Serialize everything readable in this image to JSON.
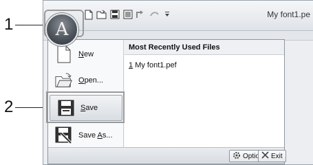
{
  "callouts": {
    "one": "1",
    "two": "2"
  },
  "window": {
    "title": "My font1.pe",
    "app_button_letter": "A"
  },
  "quick_access": [
    {
      "icon": "new-document-icon"
    },
    {
      "icon": "open-folder-icon"
    },
    {
      "icon": "save-disk-icon"
    },
    {
      "icon": "save-as-icon"
    },
    {
      "icon": "undo-icon"
    },
    {
      "icon": "redo-icon"
    },
    {
      "icon": "customize-qat-icon"
    }
  ],
  "menu": {
    "items": [
      {
        "label": "New",
        "accel": "N",
        "icon": "new-document-icon"
      },
      {
        "label": "Open...",
        "accel": "O",
        "icon": "open-folder-icon"
      },
      {
        "label": "Save",
        "accel": "S",
        "icon": "save-disk-icon"
      },
      {
        "label": "Save As...",
        "accel": "A",
        "icon": "save-as-icon"
      }
    ],
    "recent_title": "Most Recently Used Files",
    "recent_files": [
      {
        "index": "1",
        "name": "My font1.pef"
      }
    ],
    "options_label": "Options",
    "exit_label": "Exit"
  }
}
